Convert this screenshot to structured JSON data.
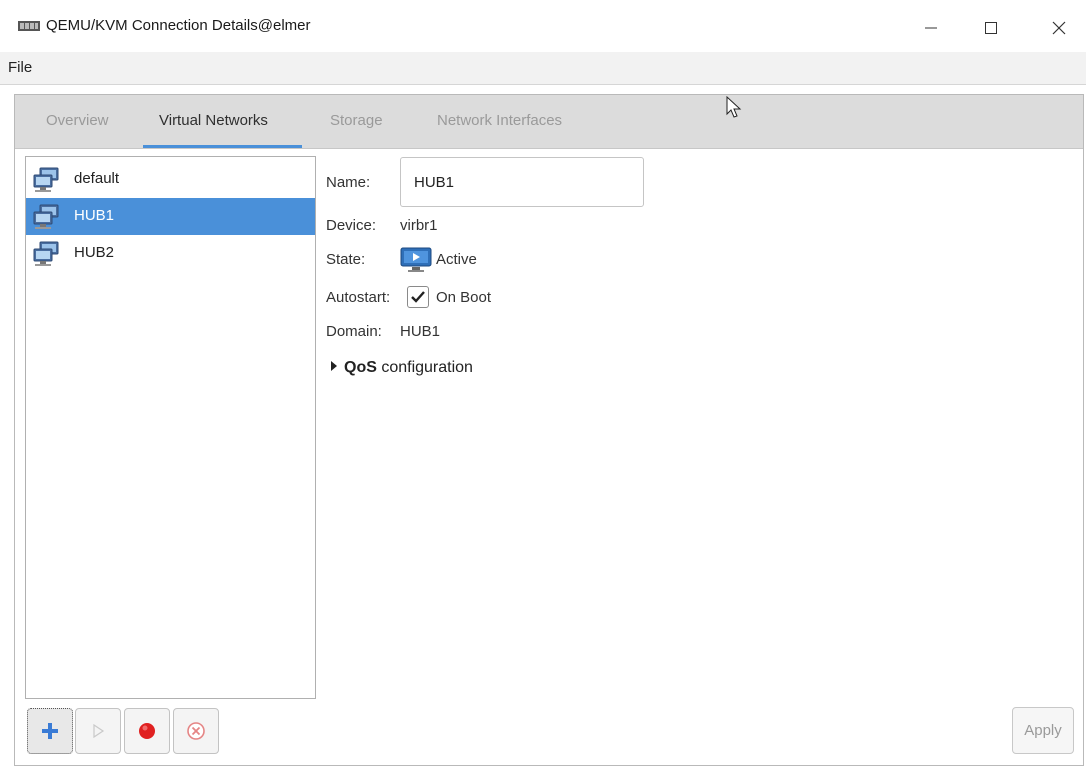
{
  "window": {
    "title": "QEMU/KVM Connection Details@elmer",
    "controls": [
      "minimize",
      "maximize",
      "close"
    ]
  },
  "menubar": {
    "file_label": "File"
  },
  "tabs": [
    {
      "label": "Overview",
      "active": false
    },
    {
      "label": "Virtual Networks",
      "active": true
    },
    {
      "label": "Storage",
      "active": false
    },
    {
      "label": "Network Interfaces",
      "active": false
    }
  ],
  "networks": [
    {
      "label": "default",
      "icon": "network-icon",
      "selected": false
    },
    {
      "label": "HUB1",
      "icon": "network-icon",
      "selected": true
    },
    {
      "label": "HUB2",
      "icon": "network-icon",
      "selected": false
    }
  ],
  "details": {
    "name_label": "Name:",
    "name_value": "HUB1",
    "device_label": "Device:",
    "device_value": "virbr1",
    "state_label": "State:",
    "state_value": "Active",
    "autostart_label": "Autostart:",
    "autostart_value": "On Boot",
    "autostart_checked": true,
    "domain_label": "Domain:",
    "domain_value": "HUB1",
    "qos_bold": "QoS",
    "qos_rest": " configuration"
  },
  "toolbar": {
    "buttons": [
      "add-network",
      "start-network",
      "stop-network",
      "delete-network"
    ],
    "apply_label": "Apply"
  },
  "colors": {
    "accent": "#4a90d9",
    "stop_red": "#e02020",
    "add_blue": "#3a7bd5"
  }
}
